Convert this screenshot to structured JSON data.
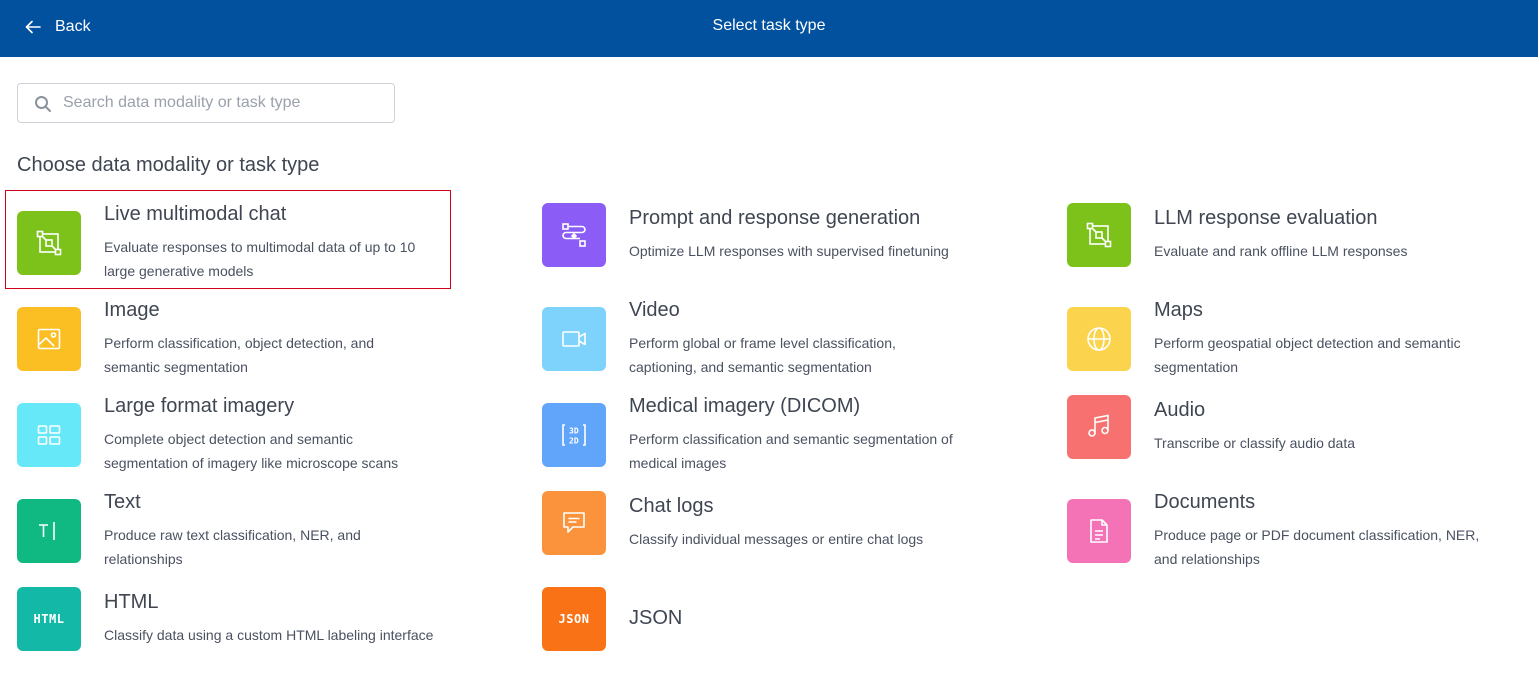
{
  "header": {
    "back_label": "Back",
    "title": "Select task type"
  },
  "search": {
    "placeholder": "Search data modality or task type",
    "value": ""
  },
  "section_heading": "Choose data modality or task type",
  "colors": {
    "header_bg": "#01519f",
    "selection_border": "#d0021b"
  },
  "task_types": [
    {
      "name": "Live multimodal chat",
      "description": "Evaluate responses to multimodal data of up to 10 large generative models",
      "icon": "multimodal-chat-icon",
      "color": "#7cc21b",
      "selected": true
    },
    {
      "name": "Prompt and response generation",
      "description": "Optimize LLM responses with supervised finetuning",
      "icon": "prompt-response-icon",
      "color": "#8b5cf6",
      "selected": false
    },
    {
      "name": "LLM response evaluation",
      "description": "Evaluate and rank offline LLM responses",
      "icon": "llm-evaluation-icon",
      "color": "#7cc21b",
      "selected": false
    },
    {
      "name": "Image",
      "description": "Perform classification, object detection, and semantic segmentation",
      "icon": "image-icon",
      "color": "#fbbf24",
      "selected": false
    },
    {
      "name": "Video",
      "description": "Perform global or frame level classification, captioning, and semantic segmentation",
      "icon": "video-icon",
      "color": "#7dd3fc",
      "selected": false
    },
    {
      "name": "Maps",
      "description": "Perform geospatial object detection and semantic segmentation",
      "icon": "globe-icon",
      "color": "#fcd34d",
      "selected": false
    },
    {
      "name": "Large format imagery",
      "description": "Complete object detection and semantic segmentation of imagery like microscope scans",
      "icon": "large-format-icon",
      "color": "#67e8f9",
      "selected": false
    },
    {
      "name": "Medical imagery (DICOM)",
      "description": "Perform classification and semantic segmentation of medical images",
      "icon": "dicom-3d-2d-icon",
      "color": "#60a5fa",
      "selected": false
    },
    {
      "name": "Audio",
      "description": "Transcribe or classify audio data",
      "icon": "music-note-icon",
      "color": "#f87171",
      "selected": false
    },
    {
      "name": "Text",
      "description": "Produce raw text classification, NER, and relationships",
      "icon": "text-cursor-icon",
      "color": "#10b981",
      "selected": false
    },
    {
      "name": "Chat logs",
      "description": "Classify individual messages or entire chat logs",
      "icon": "chat-bubble-icon",
      "color": "#fb923c",
      "selected": false
    },
    {
      "name": "Documents",
      "description": "Produce page or PDF document classification, NER, and relationships",
      "icon": "document-icon",
      "color": "#f472b6",
      "selected": false
    },
    {
      "name": "HTML",
      "description": "Classify data using a custom HTML labeling interface",
      "icon": "html-icon",
      "icon_text": "HTML",
      "color": "#14b8a6",
      "selected": false
    },
    {
      "name": "JSON",
      "description": "",
      "icon": "json-icon",
      "icon_text": "JSON",
      "color": "#f97316",
      "selected": false
    }
  ]
}
